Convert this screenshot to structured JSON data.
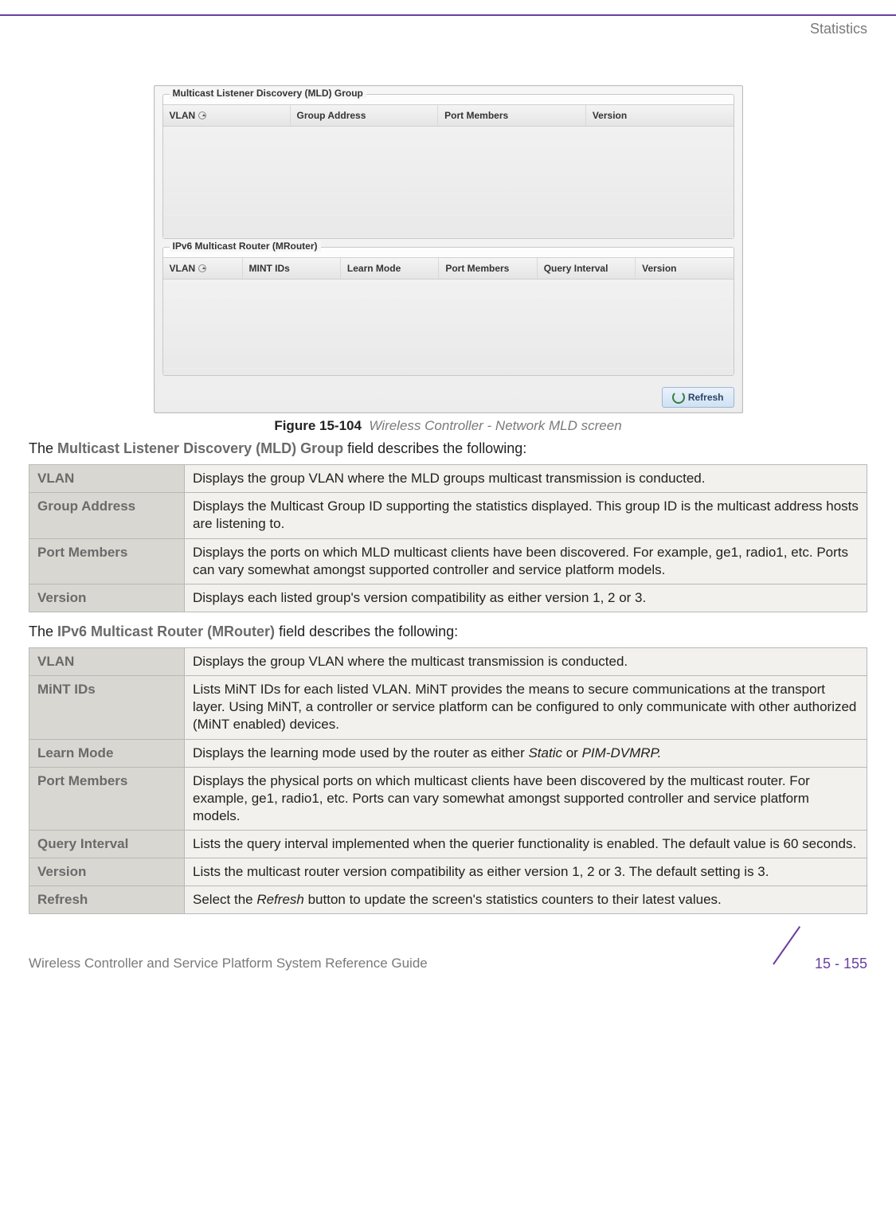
{
  "header": {
    "section": "Statistics"
  },
  "screenshot": {
    "fieldset1": {
      "legend": "Multicast Listener Discovery (MLD) Group",
      "cols": [
        "VLAN",
        "Group Address",
        "Port Members",
        "Version"
      ]
    },
    "fieldset2": {
      "legend": "IPv6 Multicast Router (MRouter)",
      "cols": [
        "VLAN",
        "MINT IDs",
        "Learn Mode",
        "Port Members",
        "Query Interval",
        "Version"
      ]
    },
    "refresh": "Refresh"
  },
  "figure": {
    "label": "Figure 15-104",
    "caption": "Wireless Controller - Network MLD screen"
  },
  "intro1_pre": "The ",
  "intro1_term": "Multicast Listener Discovery (MLD) Group",
  "intro1_post": " field describes the following:",
  "table1": [
    {
      "key": "VLAN",
      "desc": "Displays the group VLAN where the MLD groups multicast transmission is conducted."
    },
    {
      "key": "Group Address",
      "desc": "Displays the Multicast Group ID supporting the statistics displayed. This group ID is the multicast address hosts are listening to."
    },
    {
      "key": "Port Members",
      "desc": "Displays the ports on which MLD multicast clients have been discovered. For example, ge1, radio1, etc. Ports can vary somewhat amongst supported controller and service platform models."
    },
    {
      "key": "Version",
      "desc": "Displays each listed group's version compatibility as either version 1, 2 or 3."
    }
  ],
  "intro2_pre": "The ",
  "intro2_term": "IPv6 Multicast Router (MRouter)",
  "intro2_post": " field describes the following:",
  "table2": [
    {
      "key": "VLAN",
      "desc": "Displays the group VLAN where the multicast transmission is conducted."
    },
    {
      "key": "MiNT IDs",
      "desc": "Lists MiNT IDs for each listed VLAN. MiNT provides the means to secure communications at the transport layer. Using MiNT, a controller or service platform can be configured to only communicate with other authorized (MiNT enabled) devices."
    },
    {
      "key": "Learn Mode",
      "desc_pre": "Displays the learning mode used by the router as either ",
      "it1": "Static",
      "mid": " or ",
      "it2": "PIM-DVMRP."
    },
    {
      "key": "Port Members",
      "desc": "Displays the physical ports on which multicast clients have been discovered by the multicast router. For example, ge1, radio1, etc. Ports can vary somewhat amongst supported controller and service platform models."
    },
    {
      "key": "Query Interval",
      "desc": "Lists the query interval implemented when the querier functionality is enabled. The default value is 60 seconds."
    },
    {
      "key": "Version",
      "desc": "Lists the multicast router version compatibility as either version 1, 2 or 3. The default setting is 3."
    },
    {
      "key": "Refresh",
      "desc_pre": "Select the ",
      "it1": "Refresh",
      "desc_post": " button to update the screen's statistics counters to their latest values."
    }
  ],
  "footer": {
    "guide": "Wireless Controller and Service Platform System Reference Guide",
    "page": "15 - 155"
  }
}
